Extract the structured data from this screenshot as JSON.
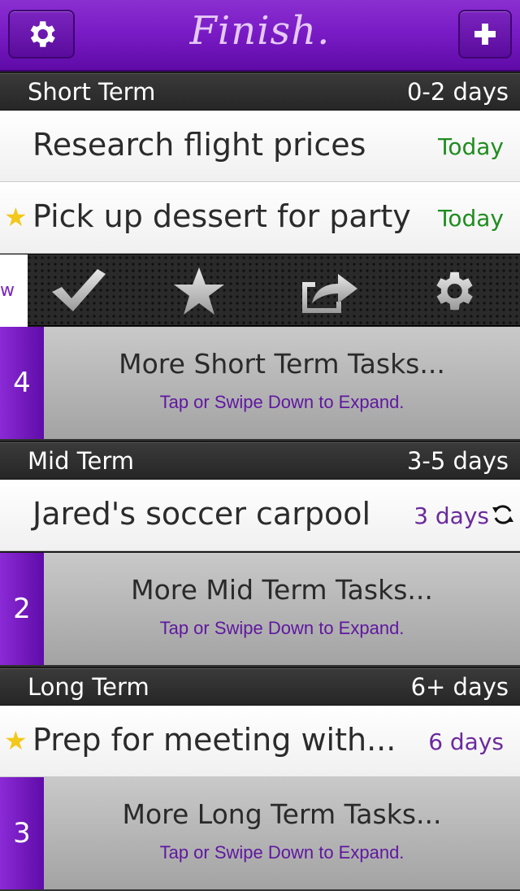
{
  "app": {
    "title": "Finish."
  },
  "toolbar": {
    "settings_icon": "gear-icon",
    "add_icon": "plus-icon"
  },
  "sections": [
    {
      "name": "Short Term",
      "range": "0-2 days"
    },
    {
      "name": "Mid Term",
      "range": "3-5 days"
    },
    {
      "name": "Long Term",
      "range": "6+ days"
    }
  ],
  "tasks": [
    {
      "title": "Research flight prices",
      "due": "Today",
      "starred": false
    },
    {
      "title": "Pick up dessert for party",
      "due": "Today",
      "starred": true
    },
    {
      "title": "Jared's soccer carpool",
      "due": "3 days",
      "starred": false,
      "repeating": true
    },
    {
      "title": "Prep for meeting with...",
      "due": "6 days",
      "starred": true
    }
  ],
  "action_bar": {
    "peek_text": "w",
    "actions": [
      "check-icon",
      "star-icon",
      "share-icon",
      "gear-icon"
    ]
  },
  "more": [
    {
      "count": "4",
      "label": "More Short Term Tasks...",
      "hint": "Tap or Swipe Down to Expand."
    },
    {
      "count": "2",
      "label": "More Mid Term Tasks...",
      "hint": "Tap or Swipe Down to Expand."
    },
    {
      "count": "3",
      "label": "More Long Term Tasks...",
      "hint": "Tap or Swipe Down to Expand."
    }
  ],
  "colors": {
    "brand": "#7a1cc6",
    "due_today": "#1f8d1f",
    "due_later": "#6b2a9e",
    "star": "#f2c81b"
  }
}
